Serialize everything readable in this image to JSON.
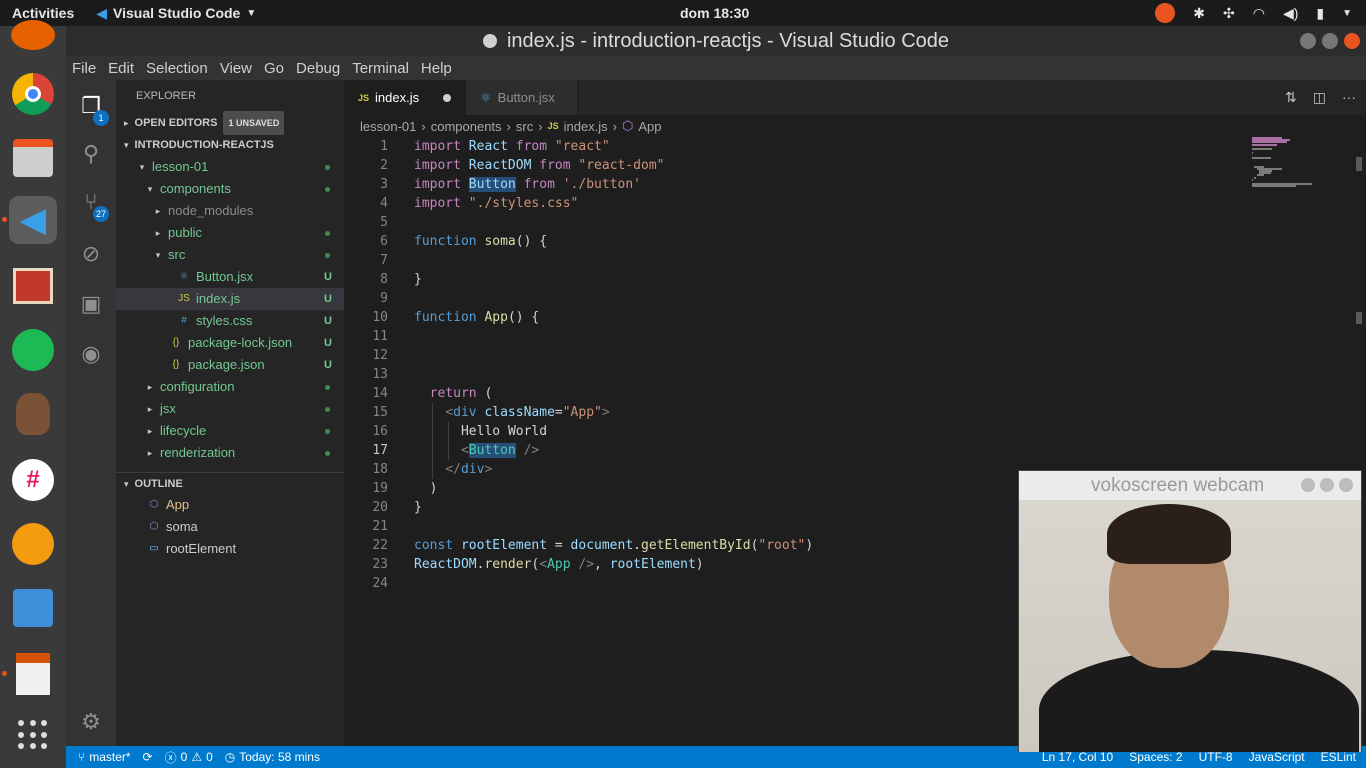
{
  "topbar": {
    "activities": "Activities",
    "app_name": "Visual Studio Code",
    "clock": "dom 18:30"
  },
  "window": {
    "title": "index.js - introduction-reactjs - Visual Studio Code"
  },
  "menu": [
    "File",
    "Edit",
    "Selection",
    "View",
    "Go",
    "Debug",
    "Terminal",
    "Help"
  ],
  "activitybar": {
    "explorer_badge": "1",
    "scm_badge": "27"
  },
  "explorer": {
    "title": "EXPLORER",
    "open_editors": "OPEN EDITORS",
    "unsaved_badge": "1 UNSAVED",
    "project": "INTRODUCTION-REACTJS",
    "outline": "OUTLINE"
  },
  "tree": [
    {
      "label": "lesson-01",
      "depth": 1,
      "twisty": "▾",
      "icon": "",
      "status": "dot",
      "color": "#73c991"
    },
    {
      "label": "components",
      "depth": 2,
      "twisty": "▾",
      "icon": "",
      "status": "dot",
      "color": "#73c991"
    },
    {
      "label": "node_modules",
      "depth": 3,
      "twisty": "▸",
      "icon": "",
      "status": "",
      "color": "#8c8c8c"
    },
    {
      "label": "public",
      "depth": 3,
      "twisty": "▸",
      "icon": "",
      "status": "dot",
      "color": "#73c991"
    },
    {
      "label": "src",
      "depth": 3,
      "twisty": "▾",
      "icon": "",
      "status": "dot",
      "color": "#73c991"
    },
    {
      "label": "Button.jsx",
      "depth": 4,
      "twisty": "",
      "icon": "⚛",
      "status": "U",
      "color": "#73c991"
    },
    {
      "label": "index.js",
      "depth": 4,
      "twisty": "",
      "icon": "JS",
      "status": "U",
      "color": "#73c991"
    },
    {
      "label": "styles.css",
      "depth": 4,
      "twisty": "",
      "icon": "#",
      "status": "U",
      "color": "#73c991"
    },
    {
      "label": "package-lock.json",
      "depth": 3,
      "twisty": "",
      "icon": "{}",
      "status": "U",
      "color": "#73c991"
    },
    {
      "label": "package.json",
      "depth": 3,
      "twisty": "",
      "icon": "{}",
      "status": "U",
      "color": "#73c991"
    },
    {
      "label": "configuration",
      "depth": 2,
      "twisty": "▸",
      "icon": "",
      "status": "dot",
      "color": "#73c991"
    },
    {
      "label": "jsx",
      "depth": 2,
      "twisty": "▸",
      "icon": "",
      "status": "dot",
      "color": "#73c991"
    },
    {
      "label": "lifecycle",
      "depth": 2,
      "twisty": "▸",
      "icon": "",
      "status": "dot",
      "color": "#73c991"
    },
    {
      "label": "renderization",
      "depth": 2,
      "twisty": "▸",
      "icon": "",
      "status": "dot",
      "color": "#73c991"
    }
  ],
  "outline_items": [
    {
      "label": "App",
      "icon": "⬡"
    },
    {
      "label": "soma",
      "icon": "⬡"
    },
    {
      "label": "rootElement",
      "icon": "▭"
    }
  ],
  "tabs": [
    {
      "label": "index.js",
      "icon": "JS",
      "active": true
    },
    {
      "label": "Button.jsx",
      "icon": "⚛",
      "active": false
    }
  ],
  "breadcrumbs": [
    "lesson-01",
    "components",
    "src",
    "index.js",
    "App"
  ],
  "code_lines": [
    "import React from \"react\"",
    "import ReactDOM from \"react-dom\"",
    "import Button from './button'",
    "import \"./styles.css\"",
    "",
    "function soma() {",
    "",
    "}",
    "",
    "function App() {",
    "",
    "",
    "",
    "  return (",
    "    <div className=\"App\">",
    "      Hello World",
    "      <Button />",
    "    </div>",
    "  )",
    "}",
    "",
    "const rootElement = document.getElementById(\"root\")",
    "ReactDOM.render(<App />, rootElement)",
    ""
  ],
  "current_line": 17,
  "status": {
    "branch": "master*",
    "errors": "0",
    "warnings": "0",
    "time": "Today: 58 mins",
    "position": "Ln 17, Col 10",
    "spaces": "Spaces: 2",
    "encoding": "UTF-8",
    "language": "JavaScript",
    "linter": "ESLint"
  },
  "webcam": {
    "title": "vokoscreen webcam"
  },
  "colors": {
    "accent": "#007acc",
    "ubuntu_orange": "#e95420"
  }
}
